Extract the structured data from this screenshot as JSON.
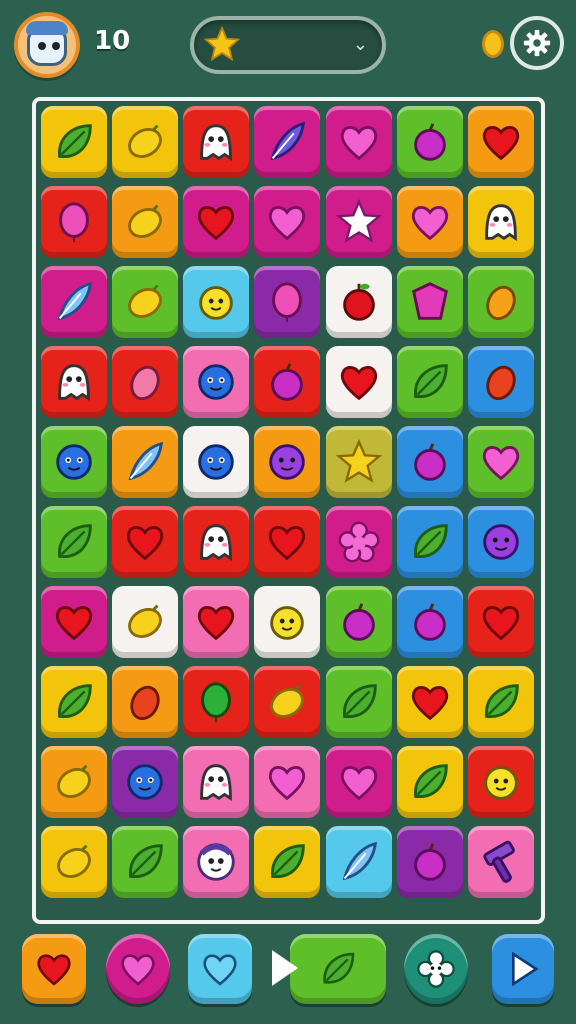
{
  "header": {
    "level": "10",
    "avatar_icon": "owl-avatar-icon",
    "star_icon": "star-icon",
    "dropdown_icon": "chevron-down-icon",
    "coin_icon": "coin-icon",
    "settings_icon": "gear-icon"
  },
  "colors": {
    "background": "#2c6150",
    "board_border": "#f3f3f3",
    "tiles": {
      "yellow": "#f2c40c",
      "orange": "#f59a13",
      "red": "#e5231b",
      "magenta": "#d11c8c",
      "green": "#5fbf2a",
      "purple": "#8b2aa8",
      "pink": "#f36db3",
      "cyan": "#54c9ec",
      "blue": "#2c8fe0",
      "white": "#f5f2f0",
      "olive": "#c2b838"
    }
  },
  "board": {
    "rows": [
      [
        {
          "bg": "yellow",
          "icon": "leaf"
        },
        {
          "bg": "yellow",
          "icon": "lemon"
        },
        {
          "bg": "red",
          "icon": "ghost"
        },
        {
          "bg": "magenta",
          "icon": "feather"
        },
        {
          "bg": "magenta",
          "icon": "heart-pink"
        },
        {
          "bg": "green",
          "icon": "plum"
        },
        {
          "bg": "orange",
          "icon": "heart-red"
        }
      ],
      [
        {
          "bg": "red",
          "icon": "balloon"
        },
        {
          "bg": "orange",
          "icon": "lemon"
        },
        {
          "bg": "magenta",
          "icon": "heart-red"
        },
        {
          "bg": "magenta",
          "icon": "heart-pink"
        },
        {
          "bg": "magenta",
          "icon": "star-white"
        },
        {
          "bg": "orange",
          "icon": "heart-pink"
        },
        {
          "bg": "yellow",
          "icon": "ghost"
        }
      ],
      [
        {
          "bg": "magenta",
          "icon": "feather-blue"
        },
        {
          "bg": "green",
          "icon": "lemon"
        },
        {
          "bg": "cyan",
          "icon": "sun-face"
        },
        {
          "bg": "purple",
          "icon": "balloon"
        },
        {
          "bg": "white",
          "icon": "apple"
        },
        {
          "bg": "green",
          "icon": "gem"
        },
        {
          "bg": "green",
          "icon": "mango"
        }
      ],
      [
        {
          "bg": "red",
          "icon": "ghost"
        },
        {
          "bg": "red",
          "icon": "mango-pink"
        },
        {
          "bg": "pink",
          "icon": "blue-face"
        },
        {
          "bg": "red",
          "icon": "plum"
        },
        {
          "bg": "white",
          "icon": "heart-red"
        },
        {
          "bg": "green",
          "icon": "leaf"
        },
        {
          "bg": "blue",
          "icon": "mango-red"
        }
      ],
      [
        {
          "bg": "green",
          "icon": "blue-face"
        },
        {
          "bg": "orange",
          "icon": "feather-blue"
        },
        {
          "bg": "white",
          "icon": "blue-face"
        },
        {
          "bg": "orange",
          "icon": "purple-face"
        },
        {
          "bg": "olive",
          "icon": "star-yellow"
        },
        {
          "bg": "blue",
          "icon": "plum"
        },
        {
          "bg": "green",
          "icon": "heart-pink"
        }
      ],
      [
        {
          "bg": "green",
          "icon": "leaf"
        },
        {
          "bg": "red",
          "icon": "heart-red"
        },
        {
          "bg": "red",
          "icon": "ghost"
        },
        {
          "bg": "red",
          "icon": "heart-red"
        },
        {
          "bg": "magenta",
          "icon": "flower"
        },
        {
          "bg": "blue",
          "icon": "leaf"
        },
        {
          "bg": "blue",
          "icon": "purple-face"
        }
      ],
      [
        {
          "bg": "magenta",
          "icon": "heart-red"
        },
        {
          "bg": "white",
          "icon": "lemon"
        },
        {
          "bg": "pink",
          "icon": "heart-red"
        },
        {
          "bg": "white",
          "icon": "sun-face"
        },
        {
          "bg": "green",
          "icon": "plum"
        },
        {
          "bg": "blue",
          "icon": "plum"
        },
        {
          "bg": "red",
          "icon": "heart-red"
        }
      ],
      [
        {
          "bg": "yellow",
          "icon": "leaf"
        },
        {
          "bg": "orange",
          "icon": "mango-red"
        },
        {
          "bg": "red",
          "icon": "balloon-green"
        },
        {
          "bg": "red",
          "icon": "lemon"
        },
        {
          "bg": "green",
          "icon": "leaf"
        },
        {
          "bg": "yellow",
          "icon": "heart-red"
        },
        {
          "bg": "yellow",
          "icon": "leaf"
        }
      ],
      [
        {
          "bg": "orange",
          "icon": "lemon"
        },
        {
          "bg": "purple",
          "icon": "blue-face"
        },
        {
          "bg": "pink",
          "icon": "ghost"
        },
        {
          "bg": "pink",
          "icon": "heart-pink"
        },
        {
          "bg": "magenta",
          "icon": "heart-pink"
        },
        {
          "bg": "yellow",
          "icon": "leaf"
        },
        {
          "bg": "red",
          "icon": "sun-face"
        }
      ],
      [
        {
          "bg": "yellow",
          "icon": "lemon"
        },
        {
          "bg": "green",
          "icon": "leaf"
        },
        {
          "bg": "pink",
          "icon": "ghost-purple"
        },
        {
          "bg": "yellow",
          "icon": "leaf"
        },
        {
          "bg": "cyan",
          "icon": "feather-blue"
        },
        {
          "bg": "purple",
          "icon": "plum"
        },
        {
          "bg": "pink",
          "icon": "hammer"
        }
      ]
    ]
  },
  "bottom_bar": [
    {
      "name": "heart-booster-button",
      "bg": "orange",
      "icon": "heart-red"
    },
    {
      "name": "pink-heart-booster-button",
      "bg": "magenta",
      "icon": "heart-pink"
    },
    {
      "name": "blue-heart-booster-button",
      "bg": "cyan",
      "icon": "heart-cyan"
    },
    {
      "name": "leaf-booster-button",
      "bg": "green",
      "icon": "leaf"
    },
    {
      "name": "shuffle-booster-button",
      "bg": "teal",
      "icon": "flower-white"
    },
    {
      "name": "play-button",
      "bg": "blue",
      "icon": "play"
    }
  ]
}
